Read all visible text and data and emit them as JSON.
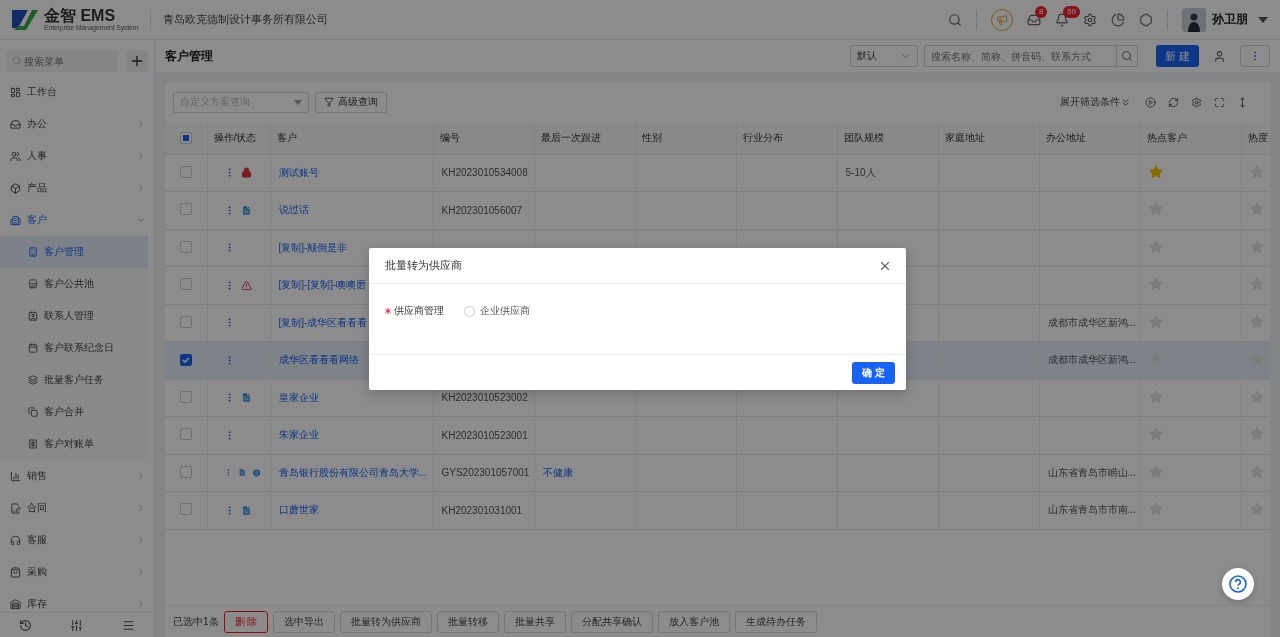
{
  "header": {
    "logo": {
      "name": "金智 EMS",
      "tagline": "Enterprise Management System"
    },
    "company": "青岛欧克德制设计事务所有限公司",
    "badges": [
      "8",
      "59"
    ],
    "user": "孙卫朋"
  },
  "sidebar": {
    "search_placeholder": "搜索菜单",
    "items": [
      {
        "label": "工作台",
        "active": false
      },
      {
        "label": "办公",
        "expanded": false,
        "active": false
      },
      {
        "label": "人事",
        "expanded": false,
        "active": false
      },
      {
        "label": "产品",
        "expanded": false,
        "active": false
      },
      {
        "label": "客户",
        "expanded": true,
        "active": true,
        "children": [
          {
            "label": "客户管理",
            "selected": true
          },
          {
            "label": "客户公共池",
            "selected": false
          },
          {
            "label": "联系人管理",
            "selected": false
          },
          {
            "label": "客户联系纪念日",
            "selected": false
          },
          {
            "label": "批量客户任务",
            "selected": false
          },
          {
            "label": "客户合并",
            "selected": false
          },
          {
            "label": "客户对账单",
            "selected": false
          }
        ]
      },
      {
        "label": "销售",
        "expanded": false,
        "active": false
      },
      {
        "label": "合同",
        "expanded": false,
        "active": false
      },
      {
        "label": "客服",
        "expanded": false,
        "active": false
      },
      {
        "label": "采购",
        "expanded": false,
        "active": false
      },
      {
        "label": "库存",
        "expanded": false,
        "active": false
      }
    ]
  },
  "page": {
    "title": "客户管理",
    "view_select": "默认",
    "search_placeholder": "搜索名称、简称、拼音码、联系方式",
    "new_button": "新 建"
  },
  "filter": {
    "scheme_placeholder": "自定义方案查询",
    "advanced": "高级查询",
    "expand": "展开筛选条件"
  },
  "table": {
    "header_indeterminate": true,
    "columns": [
      "操作/状态",
      "客户",
      "编号",
      "最后一次跟进",
      "性别",
      "行业分布",
      "团队规模",
      "家庭地址",
      "办公地址",
      "热点客户",
      "热度"
    ],
    "rows": [
      {
        "checked": false,
        "selected": false,
        "flags": [
          {
            "kind": "lock"
          }
        ],
        "name": "测试账号",
        "code": "KH2023010534008",
        "team": "5-10人",
        "hot": true
      },
      {
        "checked": false,
        "selected": false,
        "flags": [
          {
            "kind": "document"
          }
        ],
        "name": "说过话",
        "code": "KH202301056007",
        "hot": false
      },
      {
        "checked": false,
        "selected": false,
        "name": "[复制]-颠倒是非",
        "hot": false
      },
      {
        "checked": false,
        "selected": false,
        "flags": [
          {
            "kind": "warning"
          }
        ],
        "name": "[复制]-[复制]-噢噢磨",
        "hot": false
      },
      {
        "checked": false,
        "selected": false,
        "name": "[复制]-成华区看看看",
        "office": "成都市成华区新鸿...",
        "hot": false
      },
      {
        "checked": true,
        "selected": true,
        "name": "成华区看看看网络",
        "office": "成都市成华区新鸿...",
        "hot": false
      },
      {
        "checked": false,
        "selected": false,
        "flags": [
          {
            "kind": "document"
          }
        ],
        "name": "皇家企业",
        "code": "KH2023010523002",
        "hot": false
      },
      {
        "checked": false,
        "selected": false,
        "name": "朱家企业",
        "code": "KH2023010523001",
        "hot": false
      },
      {
        "checked": false,
        "selected": false,
        "flags": [
          {
            "kind": "document"
          },
          {
            "kind": "contact"
          }
        ],
        "name": "青岛银行股份有限公司青岛大学...",
        "code": "GYS202301057001",
        "last_follow": "不健康",
        "office": "山东省青岛市崂山...",
        "hot": false
      },
      {
        "checked": false,
        "selected": false,
        "flags": [
          {
            "kind": "document"
          }
        ],
        "name": "口蘑世家",
        "code": "KH202301031001",
        "office": "山东省青岛市市南...",
        "hot": false
      }
    ]
  },
  "footer": {
    "selected_count": "已选中1条",
    "buttons": [
      {
        "label": "删 除",
        "kind": "danger"
      },
      {
        "label": "选中导出",
        "kind": "default"
      },
      {
        "label": "批量转为供应商",
        "kind": "default"
      },
      {
        "label": "批量转移",
        "kind": "default"
      },
      {
        "label": "批量共享",
        "kind": "default"
      },
      {
        "label": "分配共享确认",
        "kind": "default"
      },
      {
        "label": "放入客户池",
        "kind": "default"
      },
      {
        "label": "生成待办任务",
        "kind": "default"
      }
    ]
  },
  "dialog": {
    "title": "批量转为供应商",
    "field": {
      "label": "供应商管理",
      "required": true
    },
    "options": [
      {
        "label": "企业供应商",
        "selected": false
      }
    ],
    "confirm": "确 定"
  }
}
